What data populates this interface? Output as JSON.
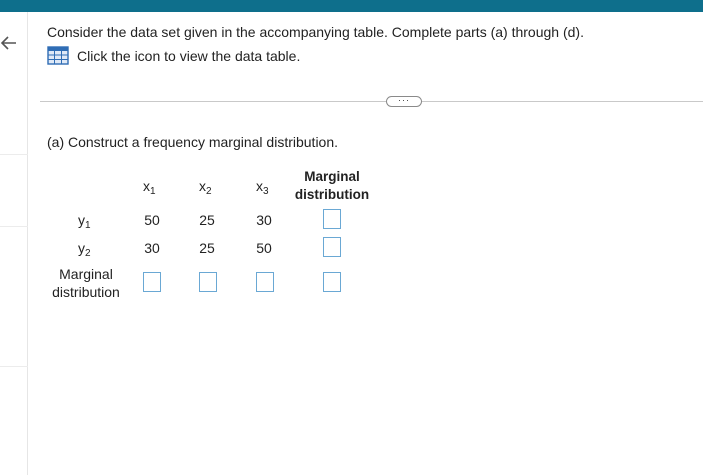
{
  "prompt": "Consider the data set given in the accompanying table. Complete parts (a) through (d).",
  "data_table_link": "Click the icon to view the data table.",
  "more_button": "···",
  "part_a": "(a) Construct a frequency marginal distribution.",
  "table": {
    "col_x1": "x",
    "col_x1_sub": "1",
    "col_x2": "x",
    "col_x2_sub": "2",
    "col_x3": "x",
    "col_x3_sub": "3",
    "col_marginal_line1": "Marginal",
    "col_marginal_line2": "distribution",
    "row_y1": "y",
    "row_y1_sub": "1",
    "row_y2": "y",
    "row_y2_sub": "2",
    "row_marginal_line1": "Marginal",
    "row_marginal_line2": "distribution",
    "y1_values": [
      "50",
      "25",
      "30"
    ],
    "y2_values": [
      "30",
      "25",
      "50"
    ]
  },
  "colors": {
    "topbar": "#0e6f8c",
    "input_border": "#6aa8d4",
    "icon_blue": "#2f6db5"
  }
}
